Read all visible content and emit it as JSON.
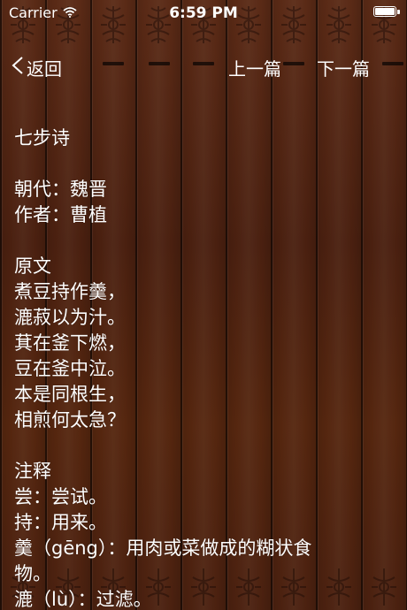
{
  "status_bar": {
    "carrier": "Carrier",
    "time": "6:59 PM"
  },
  "nav": {
    "back_label": "返回",
    "prev_label": "上一篇",
    "next_label": "下一篇"
  },
  "poem": {
    "title": "七步诗",
    "dynasty": "朝代：魏晋",
    "author": "作者：曹植",
    "original_heading": "原文",
    "lines": [
      "煮豆持作羹，",
      "漉菽以为汁。",
      "萁在釜下燃，",
      "豆在釜中泣。",
      "本是同根生，",
      "相煎何太急？"
    ],
    "notes_heading": "注释",
    "notes": [
      "尝：尝试。",
      "持：用来。",
      "羹（gēng）：用肉或菜做成的糊状食",
      "物。",
      "漉（lù）：过滤。"
    ]
  },
  "colors": {
    "wood_dark": "#4e2212",
    "text": "#ffffff"
  },
  "icons": {
    "back": "chevron-left-icon",
    "wifi": "wifi-icon",
    "battery": "battery-icon",
    "ornament": "wood-ornament-icon"
  }
}
